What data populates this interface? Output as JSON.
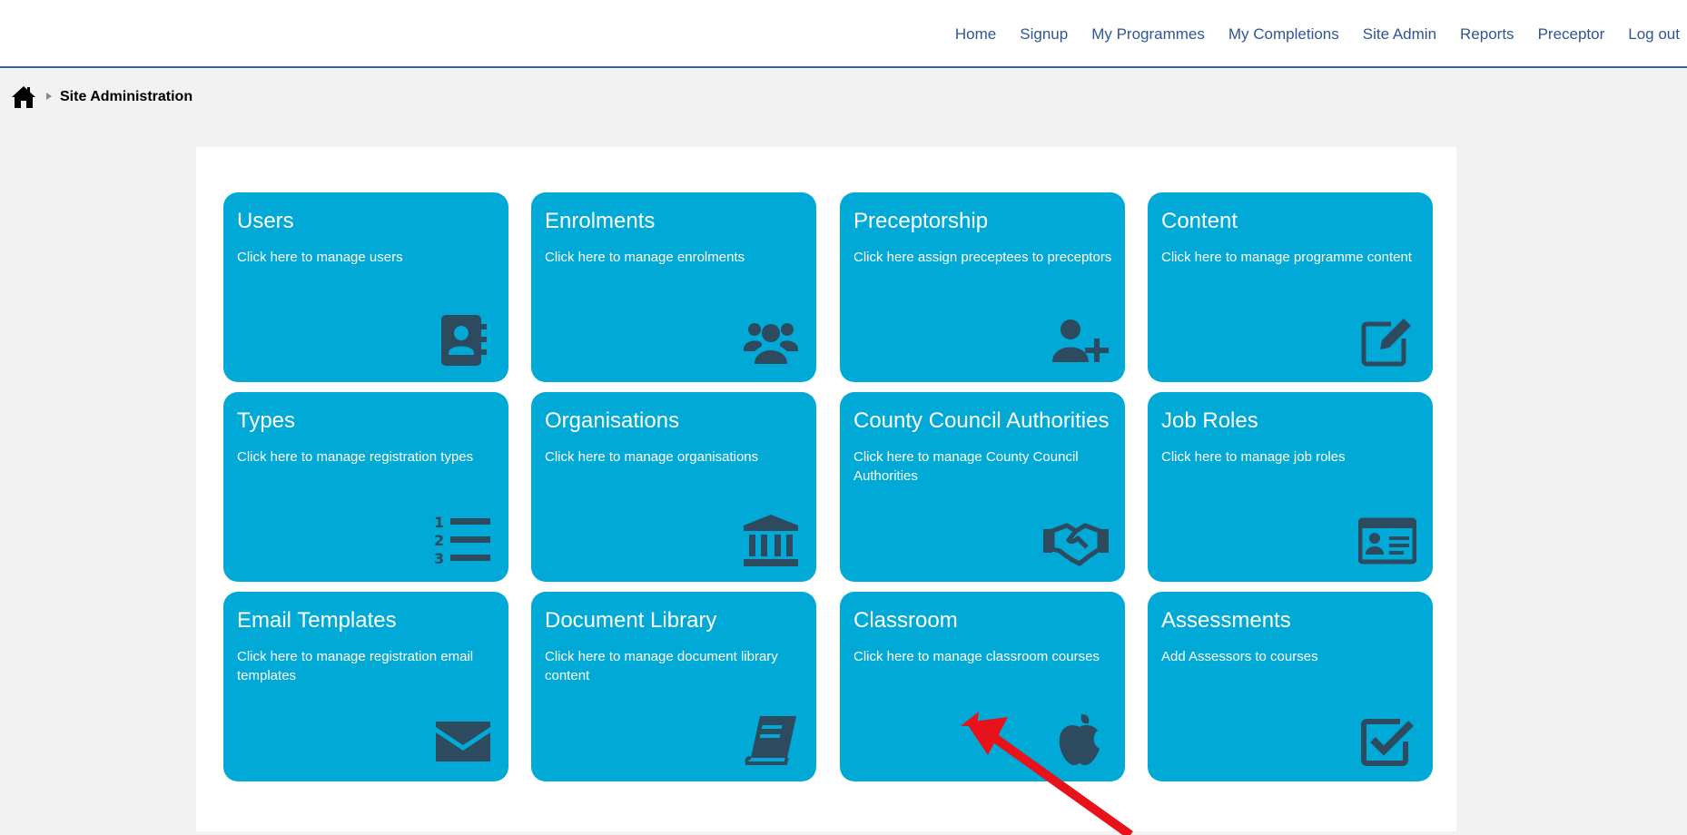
{
  "nav": {
    "items": [
      "Home",
      "Signup",
      "My Programmes",
      "My Completions",
      "Site Admin",
      "Reports",
      "Preceptor",
      "Log out"
    ]
  },
  "breadcrumb": {
    "home_icon": "home-icon",
    "separator_icon": "caret-right-icon",
    "current": "Site Administration"
  },
  "tiles": [
    {
      "title": "Users",
      "desc": "Click here to manage users",
      "icon": "address-book-icon"
    },
    {
      "title": "Enrolments",
      "desc": "Click here to manage enrolments",
      "icon": "users-icon"
    },
    {
      "title": "Preceptorship",
      "desc": "Click here assign preceptees to preceptors",
      "icon": "user-plus-icon"
    },
    {
      "title": "Content",
      "desc": "Click here to manage programme content",
      "icon": "edit-icon"
    },
    {
      "title": "Types",
      "desc": "Click here to manage registration types",
      "icon": "list-ol-icon"
    },
    {
      "title": "Organisations",
      "desc": "Click here to manage organisations",
      "icon": "university-icon"
    },
    {
      "title": "County Council Authorities",
      "desc": "Click here to manage County Council Authorities",
      "icon": "handshake-icon"
    },
    {
      "title": "Job Roles",
      "desc": "Click here to manage job roles",
      "icon": "id-card-icon"
    },
    {
      "title": "Email Templates",
      "desc": "Click here to manage registration email templates",
      "icon": "envelope-icon"
    },
    {
      "title": "Document Library",
      "desc": "Click here to manage document library content",
      "icon": "book-icon"
    },
    {
      "title": "Classroom",
      "desc": "Click here to manage classroom courses",
      "icon": "apple-icon"
    },
    {
      "title": "Assessments",
      "desc": "Add Assessors to courses",
      "icon": "check-square-icon"
    }
  ],
  "colors": {
    "tile_bg": "#00a9d6",
    "icon_fill": "#2d4a5e",
    "nav_link": "#2f5597",
    "annotation_arrow": "#e8121b"
  },
  "annotation": {
    "type": "arrow",
    "target": "Classroom"
  }
}
